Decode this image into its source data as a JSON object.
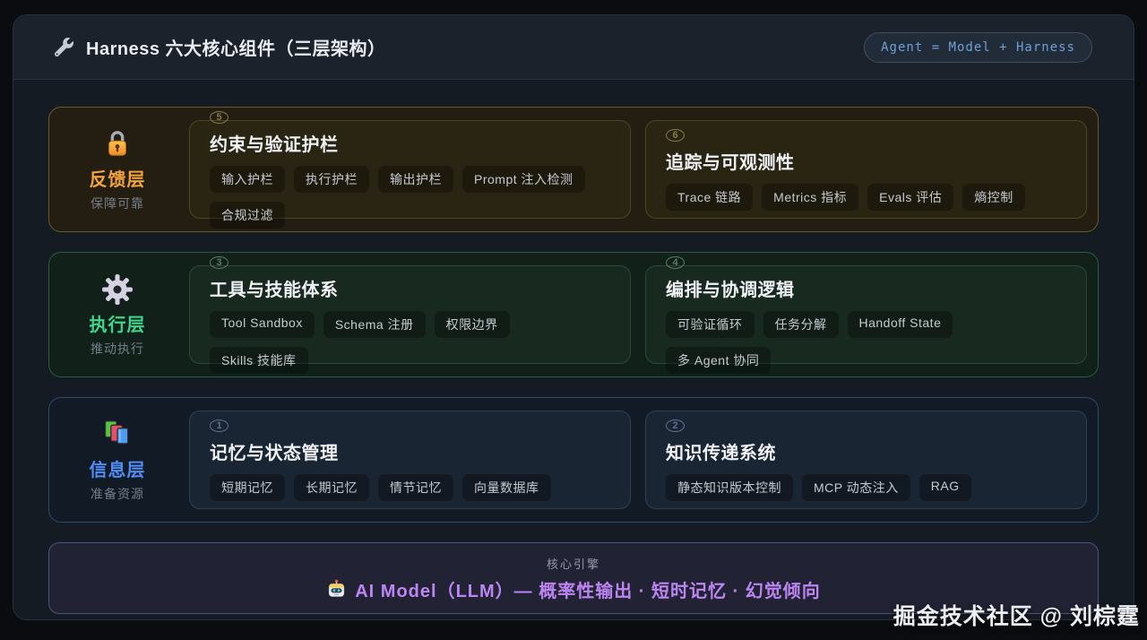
{
  "header": {
    "title": "Harness 六大核心组件（三层架构）",
    "badge": "Agent = Model + Harness"
  },
  "layers": [
    {
      "name": "反馈层",
      "subtitle": "保障可靠",
      "icon": "lock-icon",
      "accent": "#f2a33c",
      "cards": [
        {
          "number": "5",
          "title": "约束与验证护栏",
          "tags": [
            "输入护栏",
            "执行护栏",
            "输出护栏",
            "Prompt 注入检测",
            "合规过滤"
          ]
        },
        {
          "number": "6",
          "title": "追踪与可观测性",
          "tags": [
            "Trace 链路",
            "Metrics 指标",
            "Evals 评估",
            "熵控制"
          ]
        }
      ]
    },
    {
      "name": "执行层",
      "subtitle": "推动执行",
      "icon": "gear-icon",
      "accent": "#3dd68c",
      "cards": [
        {
          "number": "3",
          "title": "工具与技能体系",
          "tags": [
            "Tool Sandbox",
            "Schema 注册",
            "权限边界",
            "Skills 技能库"
          ]
        },
        {
          "number": "4",
          "title": "编排与协调逻辑",
          "tags": [
            "可验证循环",
            "任务分解",
            "Handoff State",
            "多 Agent 协同"
          ]
        }
      ]
    },
    {
      "name": "信息层",
      "subtitle": "准备资源",
      "icon": "books-icon",
      "accent": "#4f8df5",
      "cards": [
        {
          "number": "1",
          "title": "记忆与状态管理",
          "tags": [
            "短期记忆",
            "长期记忆",
            "情节记忆",
            "向量数据库"
          ]
        },
        {
          "number": "2",
          "title": "知识传递系统",
          "tags": [
            "静态知识版本控制",
            "MCP 动态注入",
            "RAG"
          ]
        }
      ]
    }
  ],
  "engine": {
    "label": "核心引擎",
    "text": "AI Model（LLM）— 概率性输出 · 短时记忆 · 幻觉倾向",
    "accent": "#bd85f2"
  },
  "watermark": "掘金技术社区 @ 刘棕霆",
  "colors": {
    "page_bg": "#0a0c10",
    "panel_bg": "#151b23",
    "badge_text": "#6f9fd8",
    "feedback_accent": "#f2a33c",
    "execution_accent": "#3dd68c",
    "information_accent": "#4f8df5",
    "engine_accent": "#bd85f2"
  }
}
